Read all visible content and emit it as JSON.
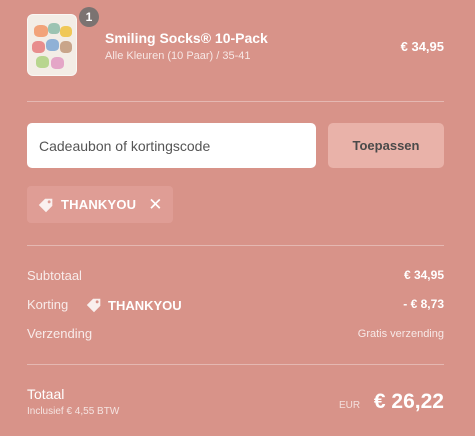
{
  "product": {
    "quantity": "1",
    "name": "Smiling Socks® 10-Pack",
    "variant": "Alle Kleuren (10 Paar) / 35-41",
    "price": "€ 34,95",
    "thumbnail_icon": "socks-image"
  },
  "discount": {
    "placeholder": "Cadeaubon of kortingscode",
    "value": "",
    "apply_label": "Toepassen",
    "applied_code": "THANKYOU",
    "remove_icon": "close-icon"
  },
  "summary": {
    "subtotal_label": "Subtotaal",
    "subtotal_value": "€ 34,95",
    "discount_label": "Korting",
    "discount_code": "THANKYOU",
    "discount_value": "- € 8,73",
    "shipping_label": "Verzending",
    "shipping_value": "Gratis verzending"
  },
  "total": {
    "label": "Totaal",
    "tax_note": "Inclusief € 4,55 BTW",
    "currency": "EUR",
    "amount": "€ 26,22"
  },
  "colors": {
    "background": "#d89389",
    "apply_button": "#e9b2a9",
    "tag_background": "#df9d95"
  }
}
